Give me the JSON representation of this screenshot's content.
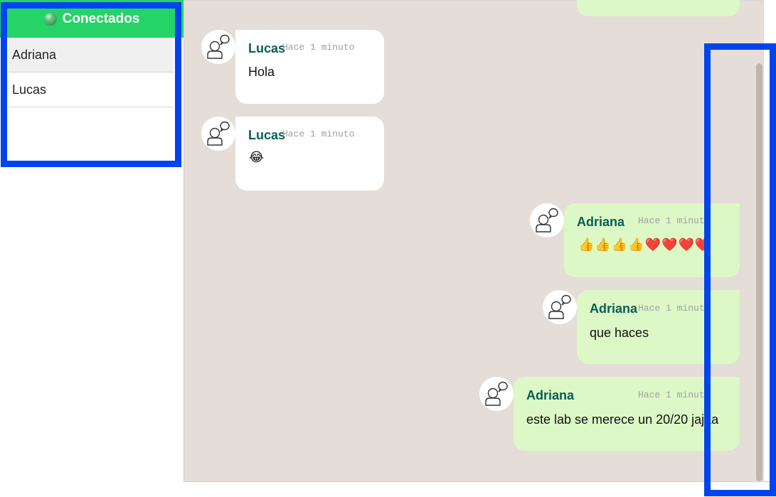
{
  "sidebar": {
    "title": "Conectados",
    "users": [
      {
        "name": "Adriana"
      },
      {
        "name": "Lucas"
      }
    ]
  },
  "chat": {
    "messages": [
      {
        "sender": "Lucas",
        "time": "Hace 1 minuto",
        "text": "Hola",
        "direction": "incoming"
      },
      {
        "sender": "Lucas",
        "time": "Hace 1 minuto",
        "text": "😂",
        "direction": "incoming"
      },
      {
        "sender": "Adriana",
        "time": "Hace 1 minuto",
        "text": "👍👍👍👍❤️❤️❤️❤️",
        "direction": "outgoing"
      },
      {
        "sender": "Adriana",
        "time": "Hace 1 minuto",
        "text": "que haces",
        "direction": "outgoing"
      },
      {
        "sender": "Adriana",
        "time": "Hace 1 minuto",
        "text": "este lab se merece un 20/20 jajaa",
        "direction": "outgoing"
      }
    ]
  },
  "colors": {
    "header_green": "#25d366",
    "chat_background": "#e5ddd7",
    "outgoing_bubble": "#dcf8c6",
    "incoming_bubble": "#ffffff",
    "sender_name": "#075e54",
    "annotation_box": "#0044ee"
  },
  "icons": {
    "online": "online-status-icon",
    "avatar": "user-chat-avatar-icon"
  }
}
